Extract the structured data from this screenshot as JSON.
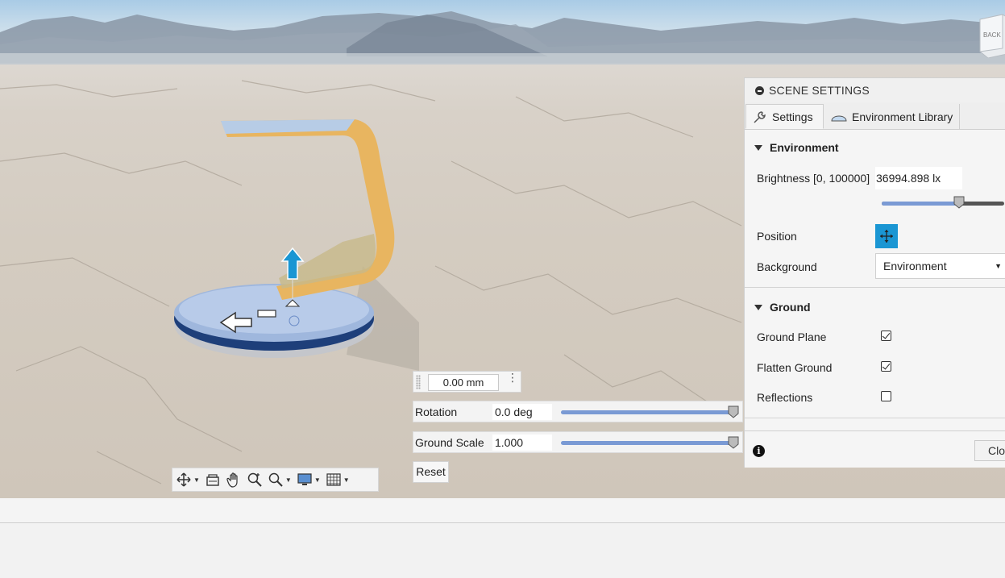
{
  "viewport": {
    "navcube_label": "BACK",
    "distance_value": "0.00 mm",
    "rotation": {
      "label": "Rotation",
      "value": "0.0 deg",
      "level": 1.0
    },
    "ground_scale": {
      "label": "Ground Scale",
      "value": "1.000",
      "level": 1.0
    },
    "reset_label": "Reset"
  },
  "nav_toolbar": {
    "icons": [
      "orbit-icon",
      "look-at-icon",
      "pan-icon",
      "zoom-icon",
      "fit-icon",
      "display-icon",
      "grid-icon"
    ]
  },
  "panel": {
    "title": "SCENE SETTINGS",
    "tabs": [
      {
        "label": "Settings",
        "active": true
      },
      {
        "label": "Environment Library",
        "active": false
      }
    ],
    "environment": {
      "heading": "Environment",
      "brightness_label": "Brightness [0, 100000]",
      "brightness_value": "36994.898 lx",
      "brightness_level": 0.66,
      "position_label": "Position",
      "background_label": "Background",
      "background_value": "Environment"
    },
    "ground": {
      "heading": "Ground",
      "ground_plane_label": "Ground Plane",
      "ground_plane_checked": true,
      "flatten_ground_label": "Flatten Ground",
      "flatten_ground_checked": true,
      "reflections_label": "Reflections",
      "reflections_checked": false
    },
    "close_label": "Clo"
  },
  "colors": {
    "accent": "#1a96d3",
    "slider_fill": "#7a9ad4",
    "model_gold": "#e8b560",
    "model_base": "#9fb7dd"
  }
}
